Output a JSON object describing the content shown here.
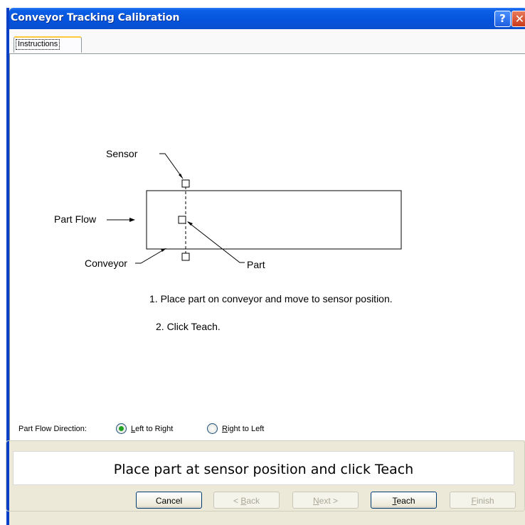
{
  "window": {
    "title": "Conveyor Tracking Calibration"
  },
  "title_buttons": {
    "help": "?",
    "close": "✕"
  },
  "tabs": [
    {
      "label": "Instructions"
    }
  ],
  "diagram": {
    "labels": {
      "sensor": "Sensor",
      "part_flow": "Part Flow",
      "conveyor": "Conveyor",
      "part": "Part"
    }
  },
  "steps": [
    "1. Place part on conveyor and move to sensor position.",
    "2. Click Teach."
  ],
  "direction": {
    "label": "Part Flow Direction:",
    "options": [
      {
        "access": "L",
        "rest": "eft to Right",
        "selected": true
      },
      {
        "access": "R",
        "rest": "ight to Left",
        "selected": false
      }
    ]
  },
  "status": {
    "message": "Place part at sensor position and click Teach"
  },
  "buttons": {
    "cancel": "Cancel",
    "back": {
      "prefix": "< ",
      "access": "B",
      "rest": "ack"
    },
    "next": {
      "access": "N",
      "rest": "ext >"
    },
    "teach": {
      "access": "T",
      "rest": "each"
    },
    "finish": {
      "access": "F",
      "rest": "inish"
    }
  }
}
